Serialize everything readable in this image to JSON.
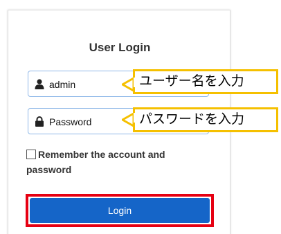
{
  "login_form": {
    "title": "User Login",
    "username_value": "admin",
    "password_placeholder": "Password",
    "remember_label": "Remember the account and password",
    "remember_checked": false,
    "login_button_label": "Login"
  },
  "annotations": {
    "username_callout": "ユーザー名を入力",
    "password_callout": "パスワードを入力",
    "callout_border_color": "#f5c000",
    "highlight_color": "#e60012"
  },
  "colors": {
    "button_blue": "#1565c8",
    "field_border": "#8fb8e8"
  },
  "icons": {
    "username": "user-icon",
    "password": "lock-icon"
  }
}
